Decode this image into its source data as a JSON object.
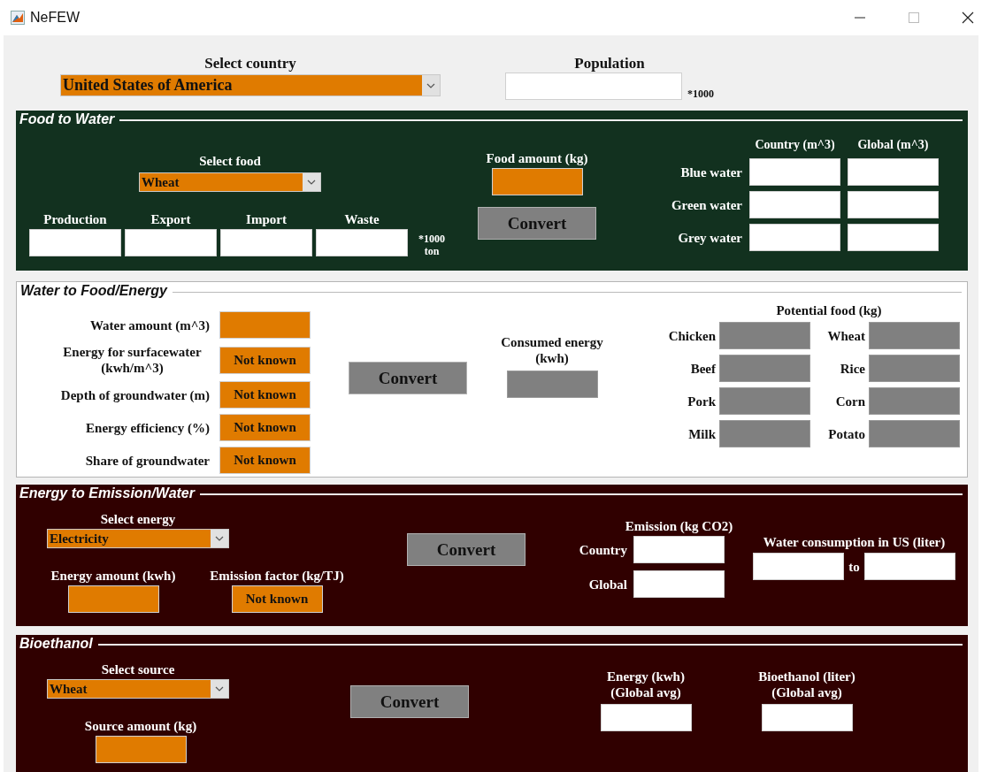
{
  "window": {
    "title": "NeFEW"
  },
  "country": {
    "label": "Select country",
    "value": "United States of America"
  },
  "population": {
    "label": "Population",
    "unit": "*1000"
  },
  "food_to_water": {
    "title": "Food to Water",
    "food_select": {
      "label": "Select food",
      "value": "Wheat"
    },
    "flows": [
      {
        "label": "Production"
      },
      {
        "label": "Export"
      },
      {
        "label": "Import"
      },
      {
        "label": "Waste"
      }
    ],
    "flow_unit": "*1000 ton",
    "food_amount": {
      "label": "Food amount (kg)"
    },
    "convert": "Convert",
    "footprint": {
      "columns": [
        "Country (m^3)",
        "Global (m^3)"
      ],
      "rows": [
        "Blue water",
        "Green water",
        "Grey water"
      ]
    }
  },
  "water_to_food_energy": {
    "title": "Water to Food/Energy",
    "inputs": [
      {
        "label": "Water amount (m^3)"
      },
      {
        "label": "Energy for surfacewater (kwh/m^3)",
        "value": "Not known"
      },
      {
        "label": "Depth of groundwater (m)",
        "value": "Not known"
      },
      {
        "label": "Energy efficiency (%)",
        "value": "Not known"
      },
      {
        "label": "Share of groundwater",
        "value": "Not known"
      }
    ],
    "convert": "Convert",
    "consumed_energy": {
      "label": "Consumed energy (kwh)"
    },
    "potential_food": {
      "title": "Potential food (kg)",
      "items": [
        "Chicken",
        "Wheat",
        "Beef",
        "Rice",
        "Pork",
        "Corn",
        "Milk",
        "Potato"
      ]
    }
  },
  "energy_to_emission_water": {
    "title": "Energy to Emission/Water",
    "energy_select": {
      "label": "Select energy",
      "value": "Electricity"
    },
    "energy_amount": {
      "label": "Energy amount (kwh)"
    },
    "emission_factor": {
      "label": "Emission factor (kg/TJ)",
      "value": "Not known"
    },
    "convert": "Convert",
    "emission": {
      "title": "Emission (kg CO2)",
      "rows": [
        "Country",
        "Global"
      ]
    },
    "water_consumption": {
      "label": "Water consumption in US (liter)",
      "separator": "to"
    }
  },
  "bioethanol": {
    "title": "Bioethanol",
    "source_select": {
      "label": "Select source",
      "value": "Wheat"
    },
    "source_amount": {
      "label": "Source amount (kg)"
    },
    "convert": "Convert",
    "outputs": [
      {
        "label": "Energy (kwh) (Global avg)"
      },
      {
        "label": "Bioethanol (liter) (Global avg)"
      }
    ]
  }
}
